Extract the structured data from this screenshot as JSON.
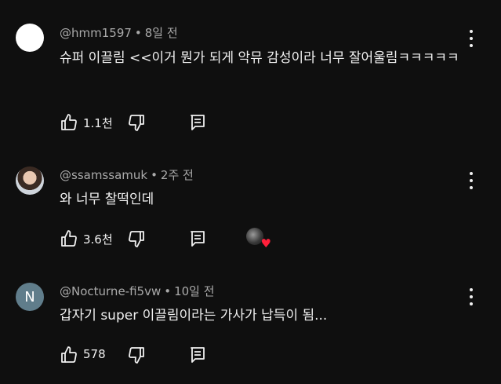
{
  "comments": [
    {
      "author": "@hmm1597",
      "time": "8일 전",
      "text": "슈퍼 이끌림 <<이거 뭔가 되게 악뮤 감성이라 너무 잘어울림ㅋㅋㅋㅋㅋ",
      "likes": "1.1천",
      "avatar_color": "#ffffff"
    },
    {
      "author": "@ssamssamuk",
      "time": "2주 전",
      "text": "와 너무 찰떡인데",
      "likes": "3.6천",
      "creator_heart": true
    },
    {
      "author": "@Nocturne-fi5vw",
      "time": "10일 전",
      "text": "갑자기 super 이끌림이라는 가사가 납득이 됨...",
      "likes": "578",
      "avatar_letter": "N",
      "avatar_color": "#607d8b"
    }
  ],
  "colors": {
    "background": "#0f0f0f",
    "meta": "#aaaaaa",
    "heart": "#ff1f3a"
  },
  "icons": [
    "thumbs-up-icon",
    "thumbs-down-icon",
    "reply-icon",
    "more-vert-icon",
    "heart-icon"
  ]
}
